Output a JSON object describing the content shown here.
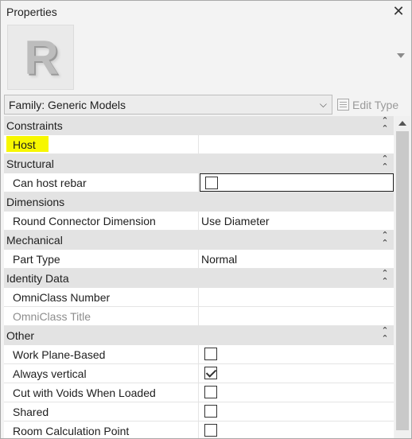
{
  "window": {
    "title": "Properties",
    "close_glyph": "✕"
  },
  "preview": {
    "logo_letter": "R"
  },
  "type_selector": {
    "value": "Family: Generic Models",
    "chevron": "⌵"
  },
  "edit_type": {
    "label": "Edit Type"
  },
  "groups": {
    "constraints": "Constraints",
    "structural": "Structural",
    "dimensions": "Dimensions",
    "mechanical": "Mechanical",
    "identity": "Identity Data",
    "other": "Other"
  },
  "collapse_glyph": "⌃\n⌃",
  "properties": {
    "host": {
      "name": "Host",
      "value": ""
    },
    "can_host_rebar": {
      "name": "Can host rebar",
      "checked": false
    },
    "round_connector": {
      "name": "Round Connector Dimension",
      "value": "Use Diameter"
    },
    "part_type": {
      "name": "Part Type",
      "value": "Normal"
    },
    "omniclass_number": {
      "name": "OmniClass Number",
      "value": ""
    },
    "omniclass_title": {
      "name": "OmniClass Title",
      "value": ""
    },
    "work_plane_based": {
      "name": "Work Plane-Based",
      "checked": false
    },
    "always_vertical": {
      "name": "Always vertical",
      "checked": true
    },
    "cut_with_voids": {
      "name": "Cut with Voids When Loaded",
      "checked": false
    },
    "shared": {
      "name": "Shared",
      "checked": false
    },
    "room_calc_point": {
      "name": "Room Calculation Point",
      "checked": false
    }
  },
  "colors": {
    "highlight": "#f7f700",
    "group_bg": "#e3e3e3",
    "disabled_text": "#8d8d8d"
  }
}
